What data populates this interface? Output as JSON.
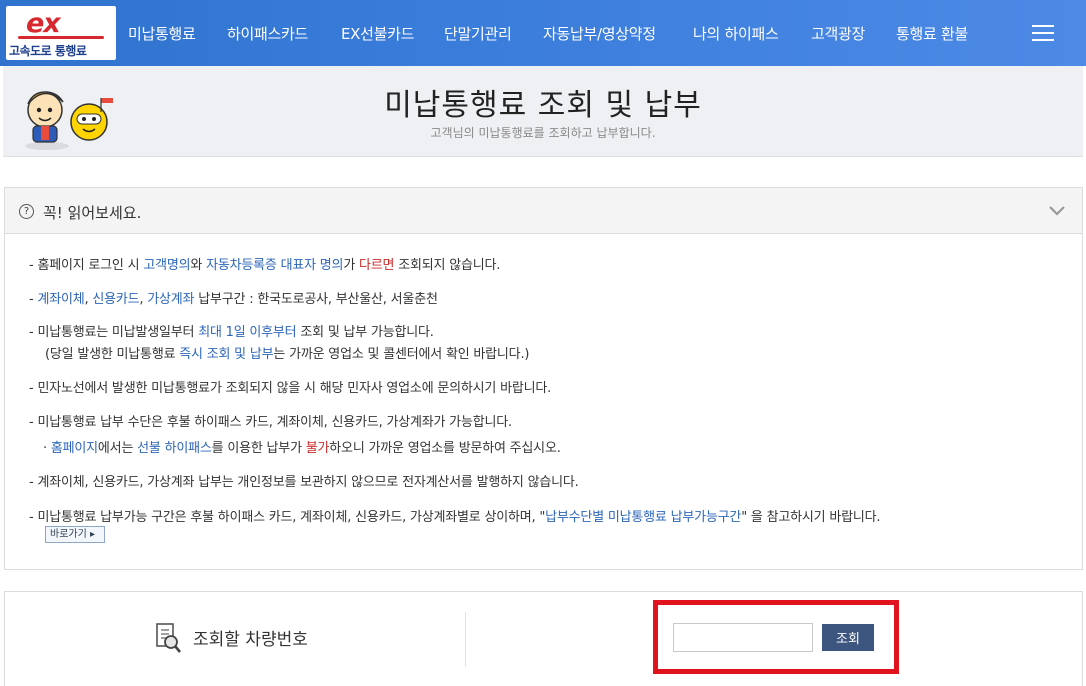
{
  "nav": {
    "logo_mark": "ex",
    "logo_text": "고속도로 통행료",
    "items": [
      "미납통행료",
      "하이패스카드",
      "EX선불카드",
      "단말기관리",
      "자동납부/영상약정",
      "나의 하이패스",
      "고객광장",
      "통행료 환불"
    ],
    "menu_icon": "hamburger-icon"
  },
  "header": {
    "title": "미납통행료 조회 및 납부",
    "subtitle": "고객님의 미납통행료를 조회하고 납부합니다."
  },
  "notice": {
    "title": "꼭! 읽어보세요.",
    "lines": [
      [
        "- ",
        "홈페이지 로그인 시 ",
        "고객명의",
        "와 ",
        "자동차등록증 대표자 명의",
        "가 ",
        "다르면",
        " 조회되지 않습니다."
      ],
      [
        "- ",
        "계좌이체",
        ", ",
        "신용카드",
        ", ",
        "가상계좌",
        " 납부구간 : 한국도로공사, 부산울산, 서울춘천"
      ],
      [
        "- ",
        "미납통행료는 미납발생일부터 ",
        "최대 1일 이후부터",
        " 조회 및 납부 가능합니다."
      ],
      [
        "(당일 발생한 미납통행료 ",
        "즉시 조회 및 납부",
        "는 가까운 영업소 및 콜센터에서 확인 바랍니다.)"
      ],
      [
        "- ",
        "민자노선에서 발생한 미납통행료가 조회되지 않을 시 해당 민자사 영업소에 문의하시기 바랍니다."
      ],
      [
        "- ",
        "미납통행료 납부 수단은 후불 하이패스 카드, 계좌이체, 신용카드, 가상계좌가 가능합니다."
      ],
      [
        "· ",
        "홈페이지",
        "에서는 ",
        "선불 하이패스",
        "를 이용한 납부가 ",
        "불가",
        "하오니 가까운 영업소를 방문하여 주십시오."
      ],
      [
        "- ",
        "계좌이체, 신용카드, 가상계좌 납부는 개인정보를 보관하지 않으므로 전자계산서를 발행하지 않습니다."
      ],
      [
        "- ",
        "미납통행료 납부가능 구간은 후불 하이패스 카드, 계좌이체, 신용카드, 가상계좌별로 상이하며, \"",
        "납부수단별 미납통행료 납부가능구간",
        "\" 을 참고하시기 바랍니다."
      ]
    ],
    "go_label": "바로가기 ▸"
  },
  "search": {
    "label": "조회할 차량번호",
    "input_value": "",
    "button_label": "조회"
  },
  "colors": {
    "nav_bg": "#3b7ddb",
    "accent_blue": "#2c66b8",
    "accent_red": "#cc2a2a",
    "highlight_box": "#e0141f",
    "query_button": "#3d5680"
  }
}
